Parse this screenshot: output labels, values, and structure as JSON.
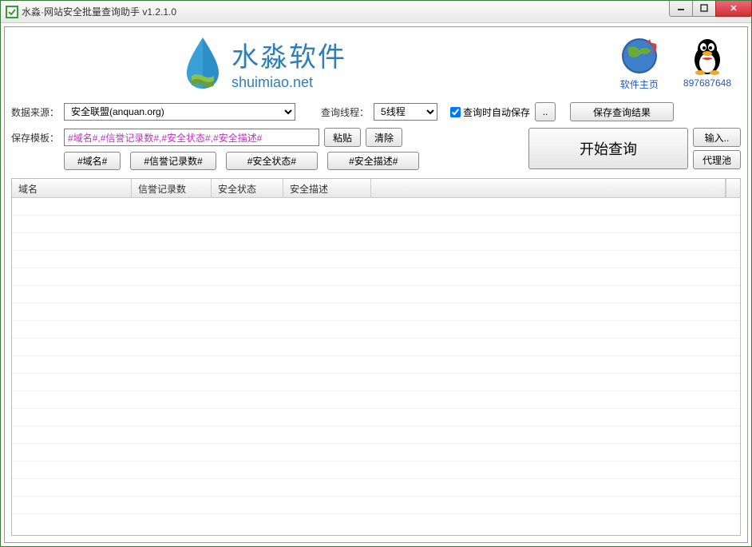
{
  "window": {
    "title": "水淼·网站安全批量查询助手 v1.2.1.0"
  },
  "logo": {
    "main": "水淼软件",
    "sub": "shuimiao.net"
  },
  "header_links": {
    "home": "软件主页",
    "qq": "897687648"
  },
  "controls": {
    "source_label": "数据来源：",
    "source_value": "安全联盟(anquan.org)",
    "thread_label": "查询线程：",
    "thread_value": "5线程",
    "autosave_label": "查询时自动保存",
    "autosave_checked": true,
    "browse_btn": "..",
    "save_result_btn": "保存查询结果",
    "template_label": "保存模板：",
    "template_value": "#域名#,#信誉记录数#,#安全状态#,#安全描述#",
    "paste_btn": "粘贴",
    "clear_btn": "清除",
    "start_btn": "开始查询",
    "input_btn": "输入..",
    "proxy_btn": "代理池",
    "tags": [
      "#域名#",
      "#信誉记录数#",
      "#安全状态#",
      "#安全描述#"
    ]
  },
  "table": {
    "columns": [
      "域名",
      "信誉记录数",
      "安全状态",
      "安全描述"
    ],
    "rows": []
  }
}
